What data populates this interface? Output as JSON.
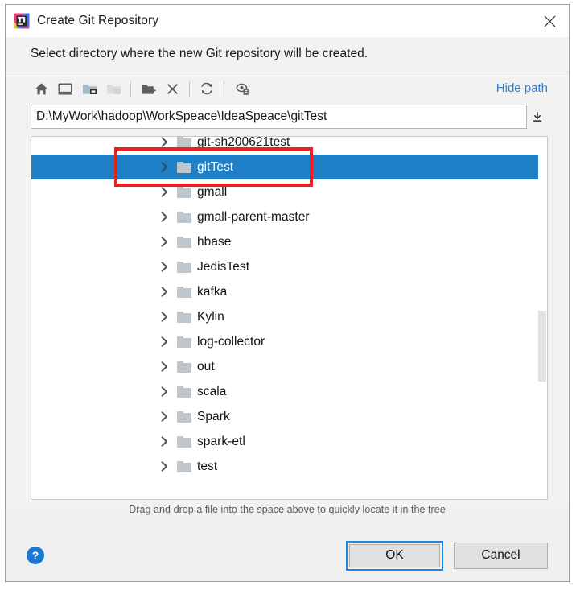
{
  "window": {
    "title": "Create Git Repository",
    "app_icon": "intellij-idea-icon",
    "close_icon": "close-icon"
  },
  "description": "Select directory where the new Git repository will be created.",
  "toolbar": {
    "buttons": [
      {
        "name": "home-icon",
        "tooltip": "Home",
        "enabled": true
      },
      {
        "name": "desktop-icon",
        "tooltip": "Desktop",
        "enabled": true
      },
      {
        "name": "project-folder-icon",
        "tooltip": "Project Directory",
        "enabled": true
      },
      {
        "name": "module-folder-icon",
        "tooltip": "Module Directory",
        "enabled": false
      },
      {
        "name": "new-folder-icon",
        "tooltip": "New Folder",
        "enabled": true
      },
      {
        "name": "delete-icon",
        "tooltip": "Delete",
        "enabled": true
      },
      {
        "name": "refresh-icon",
        "tooltip": "Refresh",
        "enabled": true
      },
      {
        "name": "show-hidden-files-icon",
        "tooltip": "Show Hidden Files and Directories",
        "enabled": true
      }
    ],
    "hide_path_label": "Hide path"
  },
  "path_field": {
    "value": "D:\\MyWork\\hadoop\\WorkSpeace\\IdeaSpeace\\gitTest",
    "placeholder": "",
    "expand_icon": "expand-down-icon"
  },
  "tree": {
    "items": [
      {
        "label": "git-sh200621test",
        "selected": false
      },
      {
        "label": "gitTest",
        "selected": true
      },
      {
        "label": "gmall",
        "selected": false
      },
      {
        "label": "gmall-parent-master",
        "selected": false
      },
      {
        "label": "hbase",
        "selected": false
      },
      {
        "label": "JedisTest",
        "selected": false
      },
      {
        "label": "kafka",
        "selected": false
      },
      {
        "label": "Kylin",
        "selected": false
      },
      {
        "label": "log-collector",
        "selected": false
      },
      {
        "label": "out",
        "selected": false
      },
      {
        "label": "scala",
        "selected": false
      },
      {
        "label": "Spark",
        "selected": false
      },
      {
        "label": "spark-etl",
        "selected": false
      },
      {
        "label": "test",
        "selected": false
      }
    ],
    "chevron_icon": "chevron-right-icon",
    "folder_icon": "folder-icon",
    "selection_color": "#1f7fc6"
  },
  "annotation": {
    "color": "#ef1f20",
    "target": "gitTest"
  },
  "hint": "Drag and drop a file into the space above to quickly locate it in the tree",
  "footer": {
    "help_label": "?",
    "ok_label": "OK",
    "cancel_label": "Cancel",
    "focused_button": "OK"
  }
}
